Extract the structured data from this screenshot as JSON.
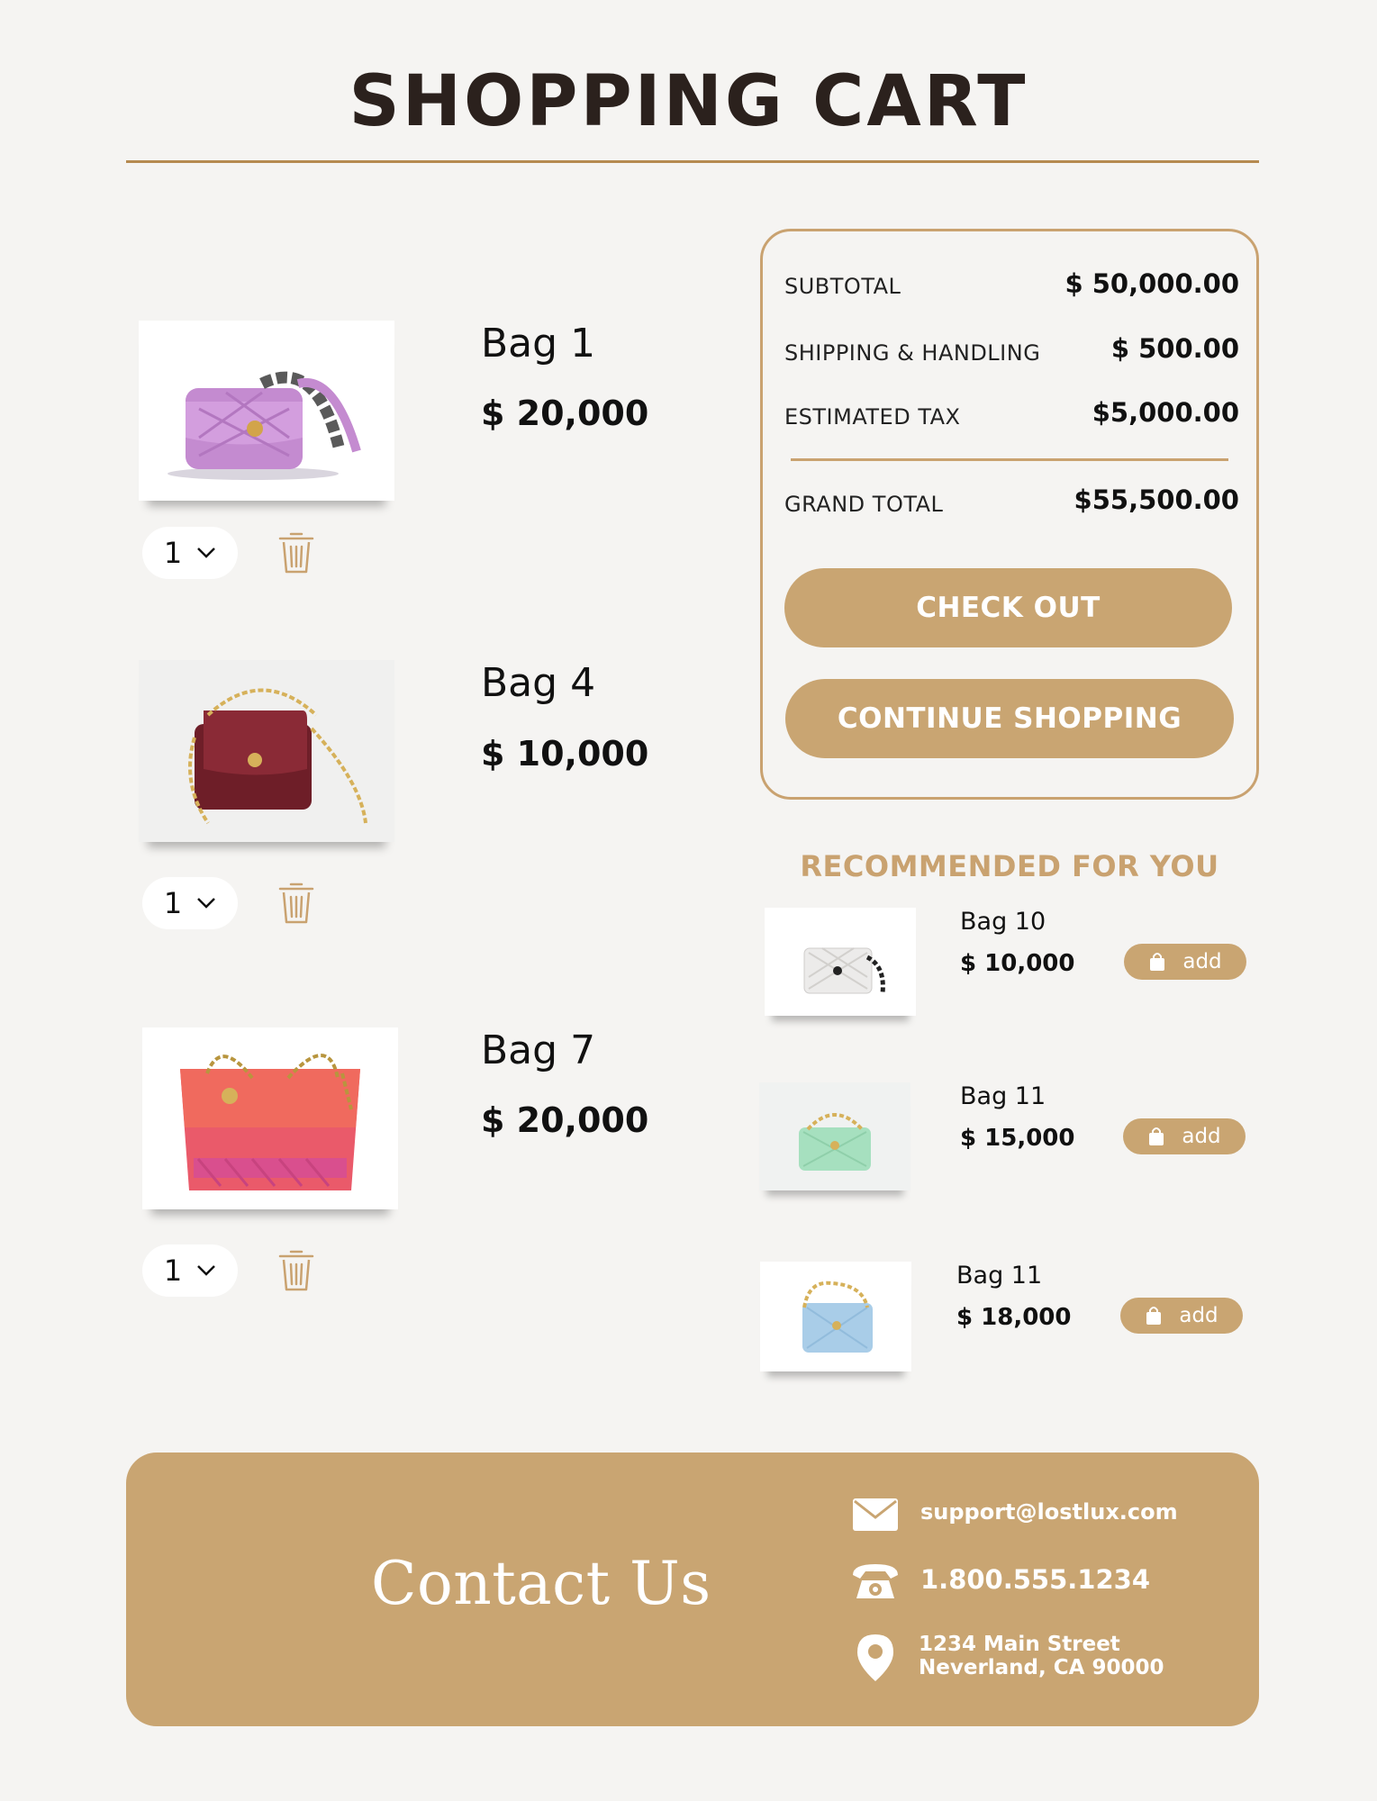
{
  "header": {
    "title": "SHOPPING CART"
  },
  "cart": {
    "items": [
      {
        "name": "Bag 1",
        "price": "$ 20,000",
        "qty": "1",
        "image": "pink-flap-bag"
      },
      {
        "name": "Bag 4",
        "price": "$ 10,000",
        "qty": "1",
        "image": "burgundy-tweed-bag"
      },
      {
        "name": "Bag 7",
        "price": "$ 20,000",
        "qty": "1",
        "image": "red-tweed-tote"
      }
    ]
  },
  "summary": {
    "subtotal_label": "SUBTOTAL",
    "subtotal_value": "$ 50,000.00",
    "shipping_label": "SHIPPING & HANDLING",
    "shipping_value": "$ 500.00",
    "tax_label": "ESTIMATED TAX",
    "tax_value": "$5,000.00",
    "grand_label": "GRAND TOTAL",
    "grand_value": "$55,500.00",
    "checkout_label": "CHECK OUT",
    "continue_label": "CONTINUE SHOPPING"
  },
  "recommended": {
    "title": "RECOMMENDED FOR YOU",
    "add_label": "add",
    "items": [
      {
        "name": "Bag 10",
        "price": "$ 10,000",
        "image": "white-quilted-bag"
      },
      {
        "name": "Bag 11",
        "price": "$ 15,000",
        "image": "mint-quilted-bag"
      },
      {
        "name": "Bag 11",
        "price": "$ 18,000",
        "image": "blue-quilted-bag"
      }
    ]
  },
  "footer": {
    "title": "Contact Us",
    "email": "support@lostlux.com",
    "phone": "1.800.555.1234",
    "address_line1": "1234 Main Street",
    "address_line2": "Neverland, CA 90000"
  },
  "colors": {
    "background": "#f5f4f2",
    "accent": "#c9a572",
    "heading": "#2b211d"
  }
}
